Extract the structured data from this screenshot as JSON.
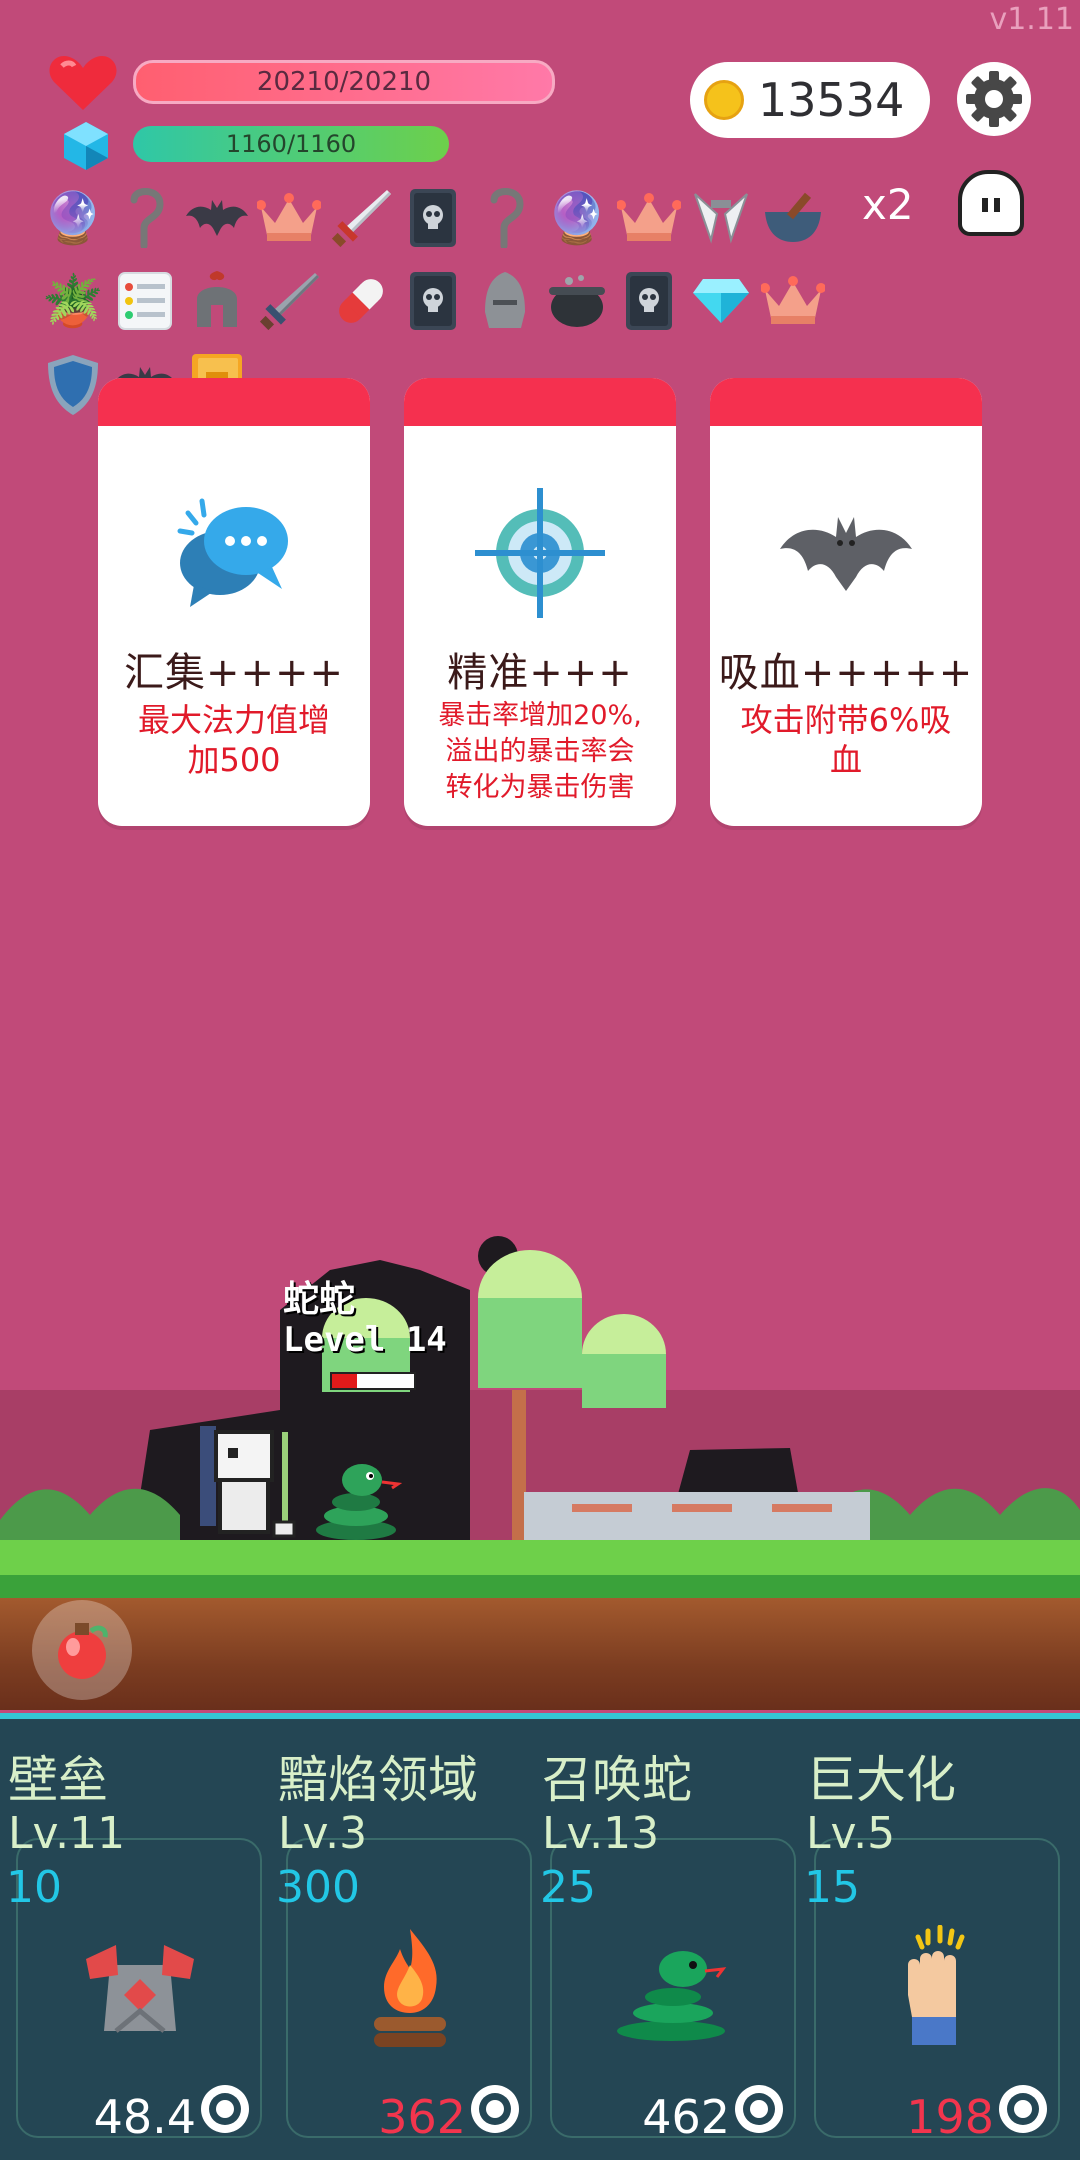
{
  "version": "v1.11",
  "stats": {
    "hp": "20210/20210",
    "mp": "1160/1160",
    "coins": "13534"
  },
  "items": {
    "row1": [
      "crystal-ball",
      "sickle",
      "bat",
      "crown",
      "sword",
      "skull-book",
      "sickle",
      "crystal-ball",
      "crown",
      "fangs",
      "mortar"
    ],
    "row2": [
      "potted-plant",
      "notepad",
      "spartan-helmet",
      "sword",
      "pill",
      "skull-book",
      "knight-helmet",
      "cauldron",
      "skull-book",
      "diamond",
      "crown"
    ],
    "row3": [
      "shield",
      "bat",
      "golden-book"
    ],
    "multiplier": "x2"
  },
  "cards": [
    {
      "title": "汇集++++",
      "desc_lines": [
        "最大法力值增",
        "加500"
      ],
      "icon": "chat-bubbles-icon"
    },
    {
      "title": "精准+++",
      "desc_lines": [
        "暴击率增加20%,",
        "溢出的暴击率会",
        "转化为暴击伤害"
      ],
      "icon": "crosshair-target-icon"
    },
    {
      "title": "吸血+++++",
      "desc_lines": [
        "攻击附带6%吸",
        "血"
      ],
      "icon": "bat-icon"
    }
  ],
  "enemy": {
    "name": "蛇蛇",
    "level": "Level 14",
    "hp_fraction": 0.3
  },
  "skills": [
    {
      "name": "壁垒",
      "level": "Lv.11",
      "cost": "10",
      "value": "48.4",
      "value_color": "white",
      "icon": "armor-icon"
    },
    {
      "name": "黯焰领域",
      "level": "Lv.3",
      "cost": "300",
      "value": "362",
      "value_color": "red",
      "icon": "campfire-icon"
    },
    {
      "name": "召唤蛇",
      "level": "Lv.13",
      "cost": "25",
      "value": "462",
      "value_color": "white",
      "icon": "snake-icon"
    },
    {
      "name": "巨大化",
      "level": "Lv.5",
      "cost": "15",
      "value": "198",
      "value_color": "red",
      "icon": "hand-icon"
    }
  ]
}
